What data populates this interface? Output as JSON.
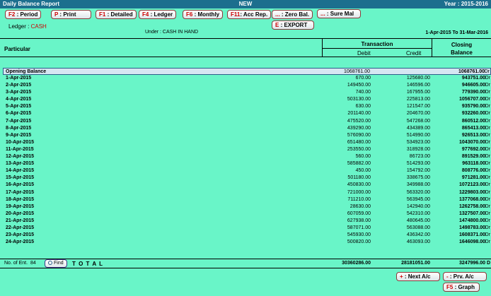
{
  "titlebar": {
    "left": "Daily Balance Report",
    "center": "NEW",
    "right": "Year : 2015-2016"
  },
  "toolbar": [
    {
      "key": "F2",
      "label": " : Period"
    },
    {
      "key": "P",
      "label": " : Print"
    },
    {
      "key": "F1",
      "label": " : Detailed"
    },
    {
      "key": "F4",
      "label": " : Ledger"
    },
    {
      "key": "F6",
      "label": " : Monthly"
    },
    {
      "key": "F11",
      "label": ": Acc Rep."
    },
    {
      "key": "...",
      "label": " : Zero Bal."
    },
    {
      "key": "...",
      "label": " : Sure Mal"
    }
  ],
  "export_button": {
    "key": "E",
    "label": " : EXPORT"
  },
  "ledger": {
    "label": "Ledger : ",
    "value": "CASH"
  },
  "under": "Under  : CASH IN HAND",
  "period": "1-Apr-2015 To 31-Mar-2016",
  "table_header": {
    "particular": "Particular",
    "transaction": "Transaction",
    "debit": "Debit",
    "credit": "Credit",
    "closing": "Closing",
    "balance": "Balance"
  },
  "opening": {
    "name": "Opening Balance",
    "debit": "1068761.00",
    "credit": "",
    "closing": "1068761.00",
    "dc": "Dr"
  },
  "rows": [
    {
      "name": "1-Apr-2015",
      "debit": "670.00",
      "credit": "125680.00",
      "closing": "943751.00",
      "dc": "Dr"
    },
    {
      "name": "2-Apr-2015",
      "debit": "149450.00",
      "credit": "146596.00",
      "closing": "946605.00",
      "dc": "Dr"
    },
    {
      "name": "3-Apr-2015",
      "debit": "740.00",
      "credit": "167955.00",
      "closing": "779390.00",
      "dc": "Dr"
    },
    {
      "name": "4-Apr-2015",
      "debit": "503130.00",
      "credit": "225813.00",
      "closing": "1056707.00",
      "dc": "Dr"
    },
    {
      "name": "5-Apr-2015",
      "debit": "630.00",
      "credit": "121547.00",
      "closing": "935790.00",
      "dc": "Dr"
    },
    {
      "name": "6-Apr-2015",
      "debit": "201140.00",
      "credit": "204670.00",
      "closing": "932260.00",
      "dc": "Dr"
    },
    {
      "name": "7-Apr-2015",
      "debit": "475520.00",
      "credit": "547268.00",
      "closing": "860512.00",
      "dc": "Dr"
    },
    {
      "name": "8-Apr-2015",
      "debit": "439290.00",
      "credit": "434389.00",
      "closing": "865413.00",
      "dc": "Dr"
    },
    {
      "name": "9-Apr-2015",
      "debit": "576090.00",
      "credit": "514990.00",
      "closing": "926513.00",
      "dc": "Dr"
    },
    {
      "name": "10-Apr-2015",
      "debit": "651480.00",
      "credit": "534923.00",
      "closing": "1043070.00",
      "dc": "Dr"
    },
    {
      "name": "11-Apr-2015",
      "debit": "253550.00",
      "credit": "318928.00",
      "closing": "977692.00",
      "dc": "Dr"
    },
    {
      "name": "12-Apr-2015",
      "debit": "560.00",
      "credit": "86723.00",
      "closing": "891529.00",
      "dc": "Dr"
    },
    {
      "name": "13-Apr-2015",
      "debit": "585882.00",
      "credit": "514293.00",
      "closing": "963118.00",
      "dc": "Dr"
    },
    {
      "name": "14-Apr-2015",
      "debit": "450.00",
      "credit": "154792.00",
      "closing": "808776.00",
      "dc": "Dr"
    },
    {
      "name": "15-Apr-2015",
      "debit": "501180.00",
      "credit": "338675.00",
      "closing": "971281.00",
      "dc": "Dr"
    },
    {
      "name": "16-Apr-2015",
      "debit": "450830.00",
      "credit": "349988.00",
      "closing": "1072123.00",
      "dc": "Dr"
    },
    {
      "name": "17-Apr-2015",
      "debit": "721000.00",
      "credit": "563320.00",
      "closing": "1229803.00",
      "dc": "Dr"
    },
    {
      "name": "18-Apr-2015",
      "debit": "711210.00",
      "credit": "563945.00",
      "closing": "1377068.00",
      "dc": "Dr"
    },
    {
      "name": "19-Apr-2015",
      "debit": "28630.00",
      "credit": "142940.00",
      "closing": "1262758.00",
      "dc": "Dr"
    },
    {
      "name": "20-Apr-2015",
      "debit": "607059.00",
      "credit": "542310.00",
      "closing": "1327507.00",
      "dc": "Dr"
    },
    {
      "name": "21-Apr-2015",
      "debit": "627938.00",
      "credit": "480645.00",
      "closing": "1474800.00",
      "dc": "Dr"
    },
    {
      "name": "22-Apr-2015",
      "debit": "587071.00",
      "credit": "563088.00",
      "closing": "1498783.00",
      "dc": "Dr"
    },
    {
      "name": "23-Apr-2015",
      "debit": "545930.00",
      "credit": "436342.00",
      "closing": "1608371.00",
      "dc": "Dr"
    },
    {
      "name": "24-Apr-2015",
      "debit": "500820.00",
      "credit": "463093.00",
      "closing": "1646098.00",
      "dc": "Dr"
    }
  ],
  "footer": {
    "no_of_ent_label": "No. of Ent.",
    "no_of_ent_value": "84",
    "find_label": "Find",
    "total_label": "T O T A L",
    "total_debit": "30360286.00",
    "total_credit": "28181051.00",
    "total_closing": "3247996.00 D"
  },
  "nav": {
    "next": {
      "key": "+",
      "label": " : Next A/c"
    },
    "prev": {
      "key": "-",
      "label": " : Prv. A/c"
    },
    "graph": {
      "key": "F5",
      "label": " : Graph"
    }
  }
}
